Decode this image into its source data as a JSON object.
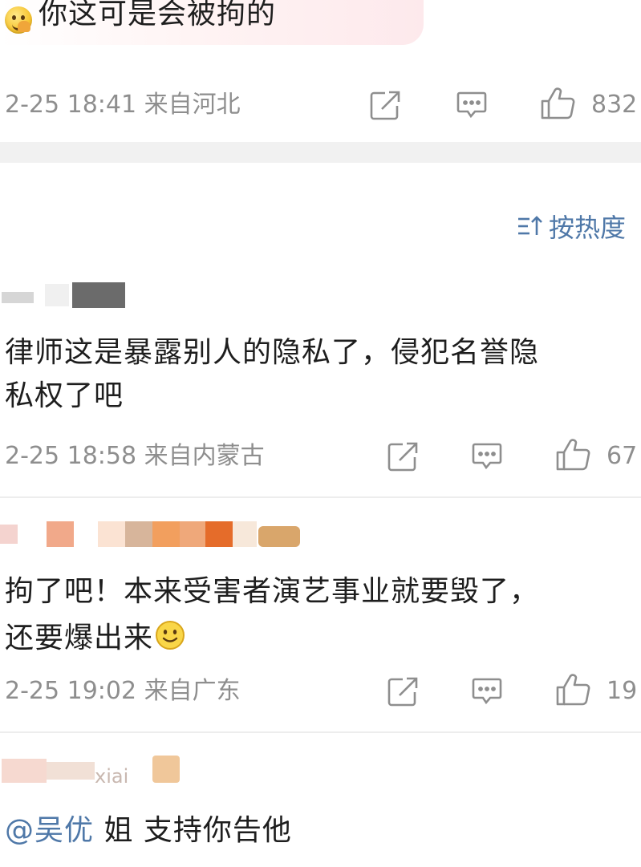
{
  "top_comment": {
    "text": "你这可是会被拘的",
    "emoji": "face-with-hand-emoji",
    "meta": "2-25 18:41 来自河北",
    "likes": "832"
  },
  "sort": {
    "icon": "sort-icon",
    "label": "按热度"
  },
  "comments": [
    {
      "text_line1": "律师这是暴露别人的隐私了，侵犯名誉隐",
      "text_line2": "私权了吧",
      "meta": "2-25 18:58 来自内蒙古",
      "likes": "67"
    },
    {
      "text_line1": "拘了吧！本来受害者演艺事业就要毁了，",
      "text_line2": "还要爆出来",
      "emoji": "smile-emoji",
      "meta": "2-25 19:02 来自广东",
      "likes": "19"
    },
    {
      "username_partial": "xiai",
      "mention": "@吴优",
      "text": " 姐 支持你告他"
    }
  ],
  "colors": {
    "link": "#4f78a8",
    "meta": "#8e8e8e",
    "separator": "#f1f1f1"
  }
}
